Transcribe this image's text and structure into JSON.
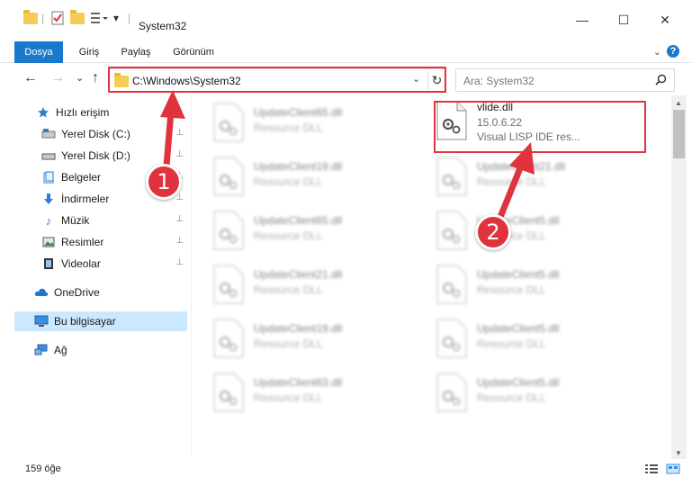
{
  "window": {
    "title": "System32",
    "minimize": "—",
    "maximize": "☐",
    "close": "✕"
  },
  "ribbon": {
    "tabs": [
      "Dosya",
      "Giriş",
      "Paylaş",
      "Görünüm"
    ],
    "collapse": "⌄",
    "help": "?"
  },
  "nav": {
    "back": "←",
    "forward": "→",
    "recent": "⌄",
    "up": "↑",
    "address": "C:\\Windows\\System32",
    "address_dropdown": "⌄",
    "refresh": "↻",
    "search_placeholder": "Ara: System32",
    "search_icon": "⚲"
  },
  "sidebar": {
    "items": [
      {
        "label": "Hızlı erişim",
        "icon": "star-icon",
        "pinned": false
      },
      {
        "label": "Yerel Disk (C:)",
        "icon": "drive-icon",
        "pinned": true
      },
      {
        "label": "Yerel Disk (D:)",
        "icon": "drive-icon",
        "pinned": true
      },
      {
        "label": "Belgeler",
        "icon": "documents-icon",
        "pinned": true
      },
      {
        "label": "İndirmeler",
        "icon": "download-icon",
        "pinned": true
      },
      {
        "label": "Müzik",
        "icon": "music-icon",
        "pinned": true
      },
      {
        "label": "Resimler",
        "icon": "pictures-icon",
        "pinned": true
      },
      {
        "label": "Videolar",
        "icon": "videos-icon",
        "pinned": true
      },
      {
        "label": "OneDrive",
        "icon": "cloud-icon",
        "pinned": false
      },
      {
        "label": "Bu bilgisayar",
        "icon": "computer-icon",
        "pinned": false
      },
      {
        "label": "Ağ",
        "icon": "network-icon",
        "pinned": false
      }
    ],
    "pin_glyph": "📌"
  },
  "files": {
    "left_column": [
      {
        "name": "UpdateClient65.dll",
        "type": "Resource DLL"
      },
      {
        "name": "UpdateClient19.dll",
        "type": "Resource DLL"
      },
      {
        "name": "UpdateClient65.dll",
        "type": "Resource DLL"
      },
      {
        "name": "UpdateClient21.dll",
        "type": "Resource DLL"
      },
      {
        "name": "UpdateClient19.dll",
        "type": "Resource DLL"
      },
      {
        "name": "UpdateClient63.dll",
        "type": "Resource DLL"
      }
    ],
    "right_column": [
      {
        "name": "vlide.dll",
        "version": "15.0.6.22",
        "description": "Visual LISP IDE res..."
      },
      {
        "name": "UpdateClient21.dll",
        "type": "Resource DLL"
      },
      {
        "name": "UpdateClient5.dll",
        "type": "Resource DLL"
      },
      {
        "name": "UpdateClient5.dll",
        "type": "Resource DLL"
      },
      {
        "name": "UpdateClient5.dll",
        "type": "Resource DLL"
      },
      {
        "name": "UpdateClient5.dll",
        "type": "Resource DLL"
      }
    ]
  },
  "status": {
    "item_count": "159 öğe"
  },
  "annotations": {
    "step1": "1",
    "step2": "2",
    "color": "#e0333d"
  },
  "colors": {
    "accent": "#1979ca",
    "selected": "#cce8ff",
    "annotation_red": "#e0333d"
  }
}
